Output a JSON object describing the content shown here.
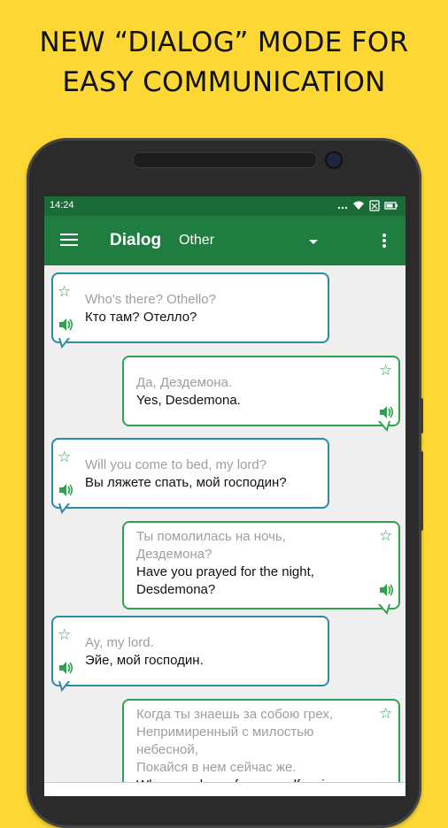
{
  "promo": {
    "line1": "NEW “DIALOG” MODE FOR",
    "line2": "EASY COMMUNICATION"
  },
  "statusbar": {
    "time": "14:24",
    "icons": [
      "dots-icon",
      "wifi-icon",
      "no-sim-icon",
      "battery-icon"
    ]
  },
  "appbar": {
    "title": "Dialog",
    "language": "Other",
    "icons": [
      "menu-icon",
      "dropdown-caret-icon",
      "more-vert-icon"
    ]
  },
  "colors": {
    "accent": "#1e7d3f",
    "left_bubble": "#2b8aa6",
    "right_bubble": "#2fa24e",
    "background": "#FDD835"
  },
  "messages": [
    {
      "side": "left",
      "source": "Who's there? Othello?",
      "translation": "Кто там? Отелло?"
    },
    {
      "side": "right",
      "source": "Да, Дездемона.",
      "translation": "Yes, Desdemona."
    },
    {
      "side": "left",
      "source": "Will you come to bed, my lord?",
      "translation": "Вы ляжете спать, мой господин?"
    },
    {
      "side": "right",
      "source_lines": [
        "Ты помолилась на ночь,",
        "Дездемона?"
      ],
      "translation_lines": [
        "Have you prayed for the night,",
        "Desdemona?"
      ]
    },
    {
      "side": "left",
      "source": "Ay, my lord.",
      "translation": "Эйе, мой господин."
    },
    {
      "side": "right",
      "source_lines": [
        "Когда ты знаешь за собою грех,",
        "Непримиренный с милостью",
        "небесной,",
        "Покайся в нем сейчас же."
      ],
      "translation_lines": [
        "When you know for yourself a sin"
      ]
    }
  ]
}
